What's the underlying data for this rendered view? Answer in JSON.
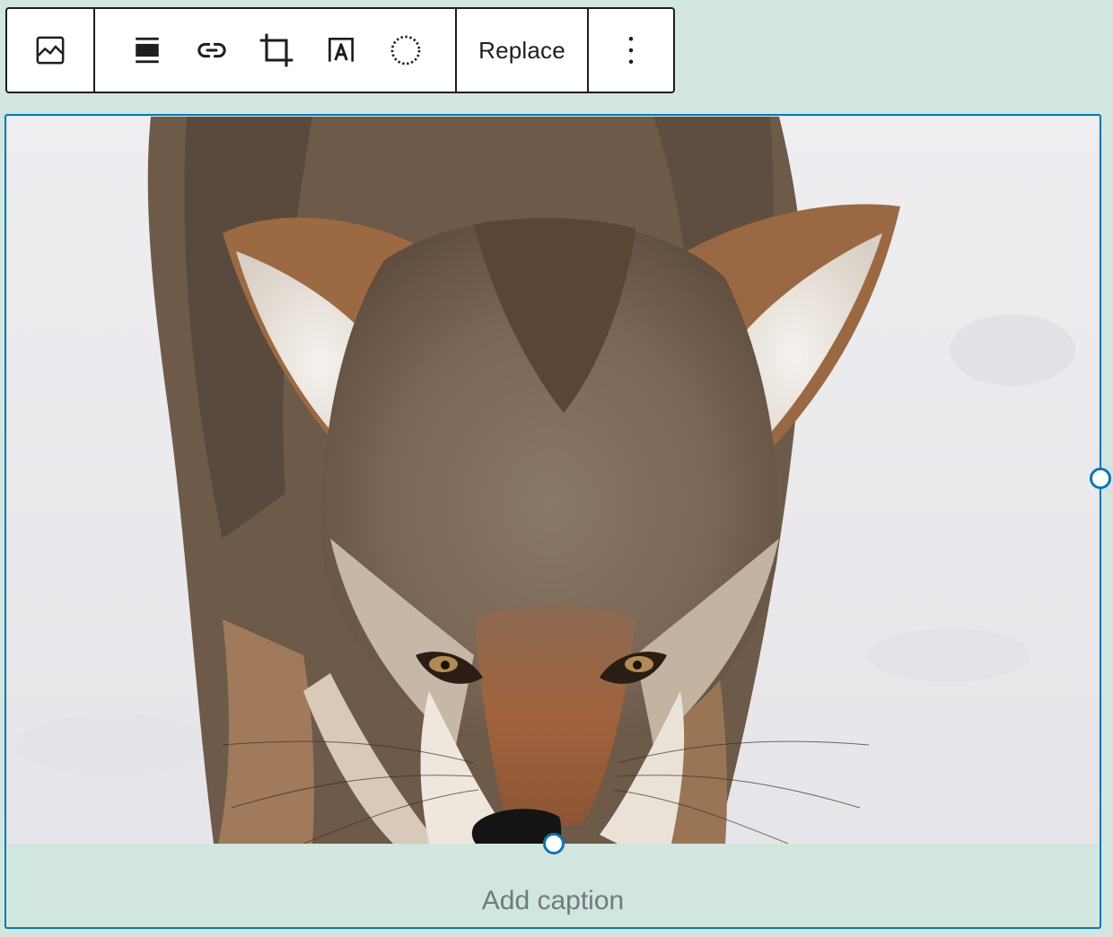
{
  "toolbar": {
    "block_type": {
      "icon": "image-icon",
      "label": "Image"
    },
    "tools": [
      {
        "name": "align-icon",
        "label": "Align"
      },
      {
        "name": "link-icon",
        "label": "Insert link"
      },
      {
        "name": "crop-icon",
        "label": "Crop"
      },
      {
        "name": "text-overlay-icon",
        "label": "Text over image"
      },
      {
        "name": "duotone-icon",
        "label": "Apply duotone filter"
      }
    ],
    "replace_label": "Replace",
    "more_options_icon": "vertical-ellipsis-icon"
  },
  "image_block": {
    "image_subject": "coyote in snow",
    "caption_placeholder": "Add caption",
    "selected_border_color": "#0b77b5"
  },
  "colors": {
    "page_background": "#d2e6e0",
    "accent": "#0b77b5",
    "toolbar_border": "#1e1e1e"
  }
}
